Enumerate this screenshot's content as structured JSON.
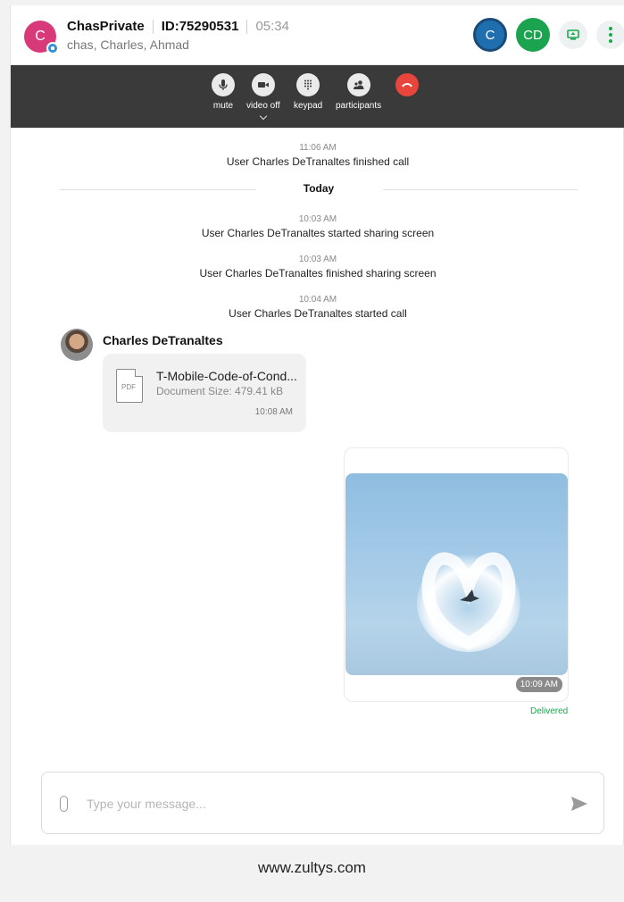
{
  "header": {
    "avatar_letter": "C",
    "room_name": "ChasPrivate",
    "room_id": "ID:75290531",
    "timer": "05:34",
    "members": "chas, Charles, Ahmad",
    "participants": [
      {
        "initials": "C",
        "color": "#1f6fae"
      },
      {
        "initials": "CD",
        "color": "#1ca34f"
      }
    ]
  },
  "call_controls": [
    {
      "label": "mute",
      "icon": "microphone-icon"
    },
    {
      "label": "video off",
      "icon": "video-camera-icon"
    },
    {
      "label": "keypad",
      "icon": "keypad-icon"
    },
    {
      "label": "participants",
      "icon": "participants-icon"
    },
    {
      "label": "",
      "icon": "hang-up-icon"
    }
  ],
  "messages": {
    "system": [
      {
        "time": "11:06 AM",
        "text": "User Charles DeTranaltes finished call"
      },
      {
        "time": "10:03 AM",
        "text": "User Charles DeTranaltes started sharing screen"
      },
      {
        "time": "10:03 AM",
        "text": "User Charles DeTranaltes finished sharing screen"
      },
      {
        "time": "10:04 AM",
        "text": "User Charles DeTranaltes started call"
      }
    ],
    "day_divider": "Today",
    "sender_name": "Charles DeTranaltes",
    "file": {
      "type_label": "PDF",
      "name": "T-Mobile-Code-of-Cond...",
      "size": "Document Size: 479.41 kB",
      "time": "10:08 AM"
    },
    "image": {
      "time": "10:09 AM",
      "status": "Delivered"
    }
  },
  "composer": {
    "placeholder": "Type your message..."
  },
  "footer": "www.zultys.com",
  "colors": {
    "accent": "#1aa84c",
    "hangup": "#e8453c",
    "callbar": "#3a3a3a",
    "room_avatar": "#d83a79"
  }
}
